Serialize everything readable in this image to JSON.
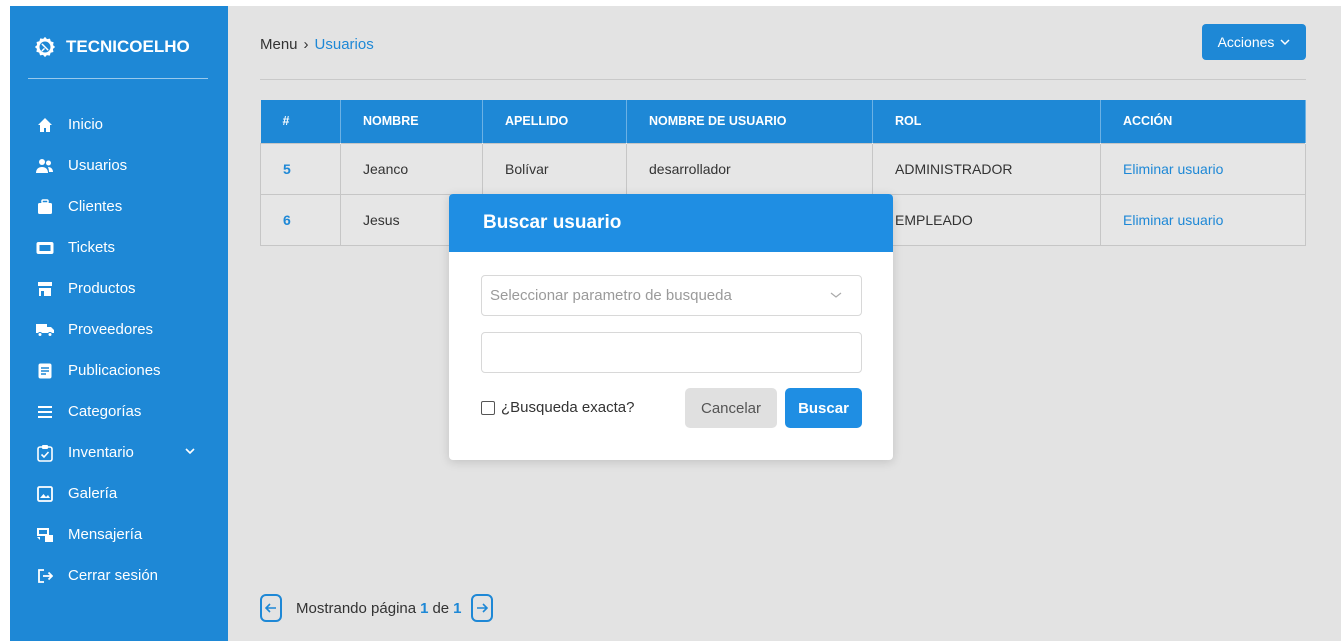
{
  "brand": {
    "name": "TECNICOELHO",
    "icon": "gear-logo-icon"
  },
  "sidebar": {
    "items": [
      {
        "label": "Inicio",
        "icon": "home-icon"
      },
      {
        "label": "Usuarios",
        "icon": "users-icon"
      },
      {
        "label": "Clientes",
        "icon": "briefcase-icon"
      },
      {
        "label": "Tickets",
        "icon": "ticket-icon"
      },
      {
        "label": "Productos",
        "icon": "store-icon"
      },
      {
        "label": "Proveedores",
        "icon": "truck-icon"
      },
      {
        "label": "Publicaciones",
        "icon": "document-icon"
      },
      {
        "label": "Categorías",
        "icon": "list-icon"
      },
      {
        "label": "Inventario",
        "icon": "clipboard-check-icon"
      },
      {
        "label": "Galería",
        "icon": "image-icon"
      },
      {
        "label": "Mensajería",
        "icon": "message-icon"
      },
      {
        "label": "Cerrar sesión",
        "icon": "logout-icon"
      }
    ]
  },
  "breadcrumb": {
    "root": "Menu",
    "separator": "›",
    "current": "Usuarios"
  },
  "header": {
    "actions_label": "Acciones"
  },
  "table": {
    "columns": [
      "#",
      "NOMBRE",
      "APELLIDO",
      "NOMBRE DE USUARIO",
      "ROL",
      "ACCIÓN"
    ],
    "rows": [
      {
        "id": "5",
        "nombre": "Jeanco",
        "apellido": "Bolívar",
        "usuario": "desarrollador",
        "rol": "ADMINISTRADOR",
        "accion": "Eliminar usuario"
      },
      {
        "id": "6",
        "nombre": "Jesus",
        "apellido": "",
        "usuario": "",
        "rol": "EMPLEADO",
        "accion": "Eliminar usuario"
      }
    ]
  },
  "pagination": {
    "prefix": "Mostrando página",
    "current": "1",
    "of": "de",
    "total": "1"
  },
  "modal": {
    "title": "Buscar usuario",
    "select_placeholder": "Seleccionar parametro de busqueda",
    "input_value": "",
    "exact_label": "¿Busqueda exacta?",
    "exact_checked": false,
    "cancel_label": "Cancelar",
    "search_label": "Buscar"
  },
  "colors": {
    "primary": "#1e88d6",
    "background": "#e3e3e3",
    "modal_header": "#1f8ee3"
  }
}
